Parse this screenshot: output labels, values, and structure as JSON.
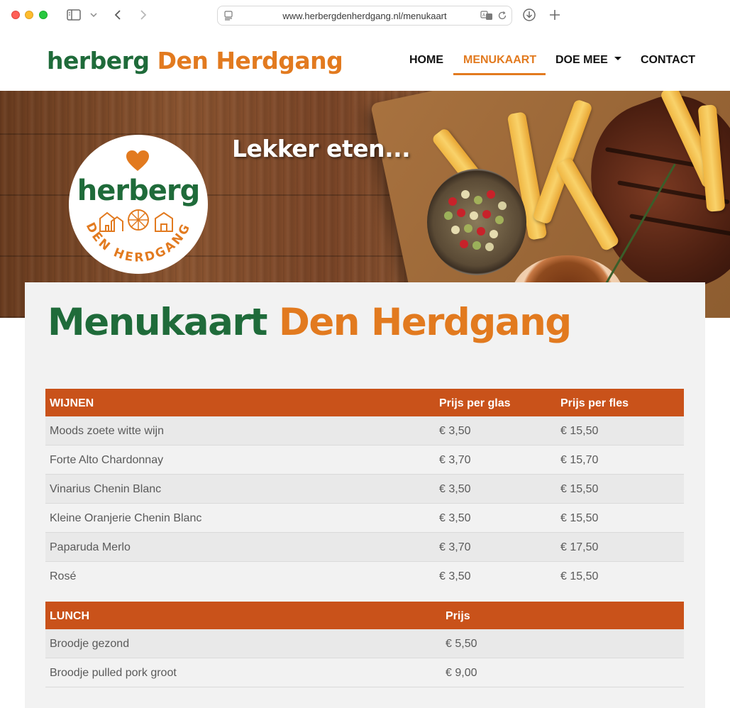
{
  "browser": {
    "url": "www.herbergdenherdgang.nl/menukaart"
  },
  "logo": {
    "part1": "herberg",
    "part2": "Den Herdgang"
  },
  "nav": {
    "home": "HOME",
    "menukaart": "MENUKAART",
    "doe_mee": "DOE MEE",
    "contact": "CONTACT"
  },
  "hero": {
    "title": "Lekker eten...",
    "badge_word": "herberg",
    "badge_arc": "DEN HERDGANG"
  },
  "page_title": {
    "part1": "Menukaart",
    "part2": "Den Herdgang"
  },
  "wines": {
    "header": {
      "name": "WIJNEN",
      "glass": "Prijs per glas",
      "bottle": "Prijs per fles"
    },
    "rows": [
      {
        "name": "Moods zoete witte wijn",
        "glass": "€ 3,50",
        "bottle": "€ 15,50"
      },
      {
        "name": "Forte Alto Chardonnay",
        "glass": "€ 3,70",
        "bottle": "€ 15,70"
      },
      {
        "name": "Vinarius Chenin Blanc",
        "glass": "€ 3,50",
        "bottle": "€ 15,50"
      },
      {
        "name": "Kleine Oranjerie Chenin Blanc",
        "glass": "€ 3,50",
        "bottle": "€ 15,50"
      },
      {
        "name": "Paparuda Merlo",
        "glass": "€ 3,70",
        "bottle": "€ 17,50"
      },
      {
        "name": "Rosé",
        "glass": "€ 3,50",
        "bottle": "€ 15,50"
      }
    ]
  },
  "lunch": {
    "header": {
      "name": "LUNCH",
      "price": "Prijs"
    },
    "rows": [
      {
        "name": "Broodje gezond",
        "price": "€ 5,50"
      },
      {
        "name": "Broodje pulled pork groot",
        "price": "€ 9,00"
      }
    ]
  },
  "colors": {
    "brand_green": "#1f6b3a",
    "brand_orange": "#e27a1f",
    "table_header": "#c9521a"
  }
}
